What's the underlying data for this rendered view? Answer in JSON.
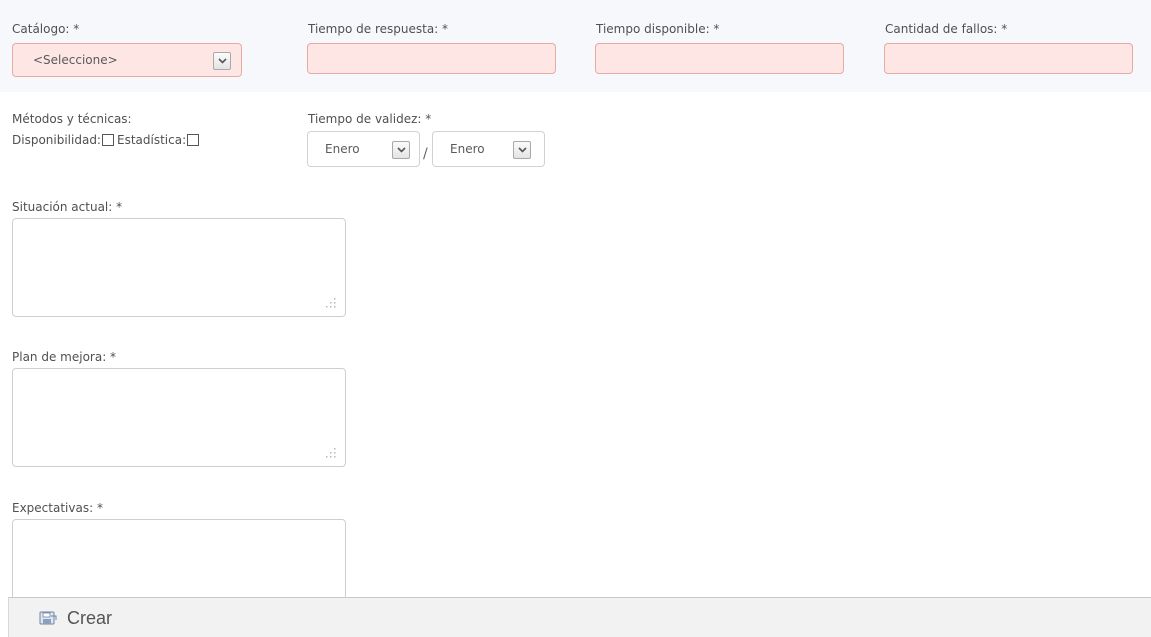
{
  "form": {
    "catalogo": {
      "label": "Catálogo: *",
      "selected": "<Seleccione>"
    },
    "tiempo_respuesta": {
      "label": "Tiempo de respuesta: *",
      "value": ""
    },
    "tiempo_disponible": {
      "label": "Tiempo disponible: *",
      "value": ""
    },
    "cantidad_fallos": {
      "label": "Cantidad de fallos: *",
      "value": ""
    },
    "metodos": {
      "label": "Métodos y técnicas:",
      "disponibilidad_label": "Disponibilidad:",
      "disponibilidad_checked": false,
      "estadistica_label": "Estadística:",
      "estadistica_checked": false
    },
    "tiempo_validez": {
      "label": "Tiempo de validez: *",
      "from_selected": "Enero",
      "separator": "/",
      "to_selected": "Enero"
    },
    "situacion_actual": {
      "label": "Situación actual: *",
      "value": ""
    },
    "plan_mejora": {
      "label": "Plan de mejora: *",
      "value": ""
    },
    "expectativas": {
      "label": "Expectativas: *",
      "value": ""
    }
  },
  "footer": {
    "create_label": "Crear",
    "create_icon": "save-icon"
  },
  "colors": {
    "required_bg": "#fde6e4",
    "required_border": "#e9a9a4",
    "footer_bg": "#f2f2f2"
  }
}
